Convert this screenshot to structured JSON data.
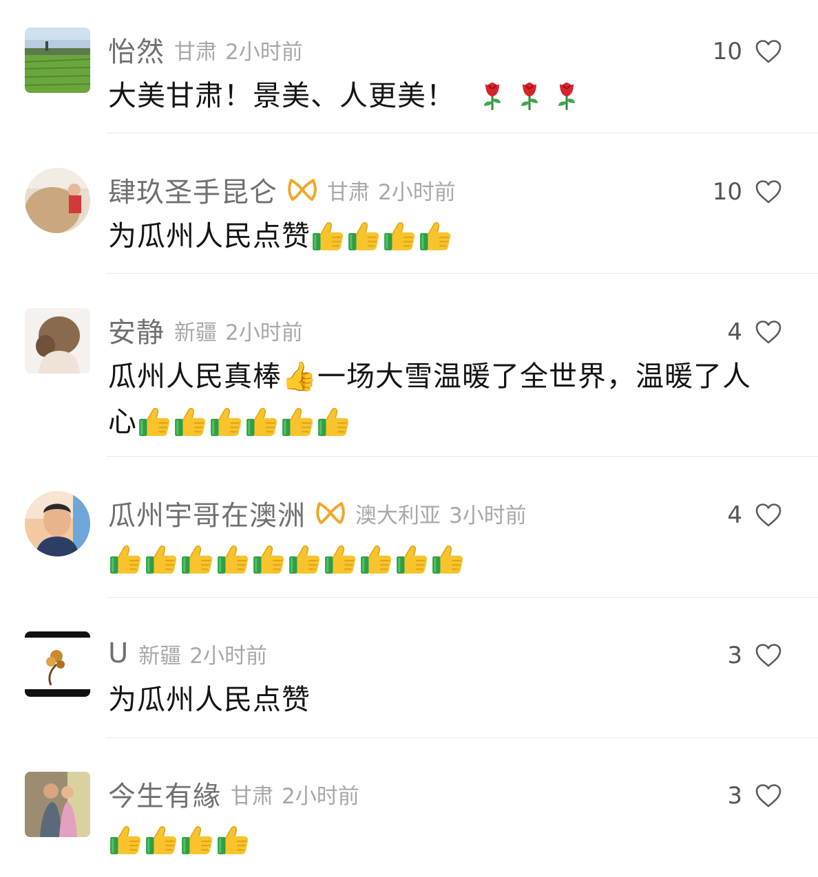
{
  "colors": {
    "username": "#707070",
    "meta": "#a8a8a8",
    "text": "#141414",
    "like_count": "#555555",
    "divider": "#e8e8e8",
    "badge": "#f4a528"
  },
  "comments": [
    {
      "username": "怡然",
      "location": "甘肃",
      "time": "2小时前",
      "likes": "10",
      "lines": [
        "大美甘肃！景美、人更美！"
      ],
      "trailing_emoji": {
        "icon": "rose-emoji",
        "count": 3
      },
      "has_badge": false,
      "avatar": "rice-field-avatar"
    },
    {
      "username": "肆玖圣手昆仑",
      "location": "甘肃",
      "time": "2小时前",
      "likes": "10",
      "lines": [
        "为瓜州人民点赞"
      ],
      "trailing_emoji": {
        "icon": "thumbs-up-emoji",
        "count": 4
      },
      "has_badge": true,
      "avatar": "person-avatar"
    },
    {
      "username": "安静",
      "location": "新疆",
      "time": "2小时前",
      "likes": "4",
      "lines": [
        "瓜州人民真棒👍一场大雪温暖了全世界，温暖了人",
        "心"
      ],
      "trailing_emoji": {
        "icon": "thumbs-up-emoji",
        "count": 6
      },
      "has_badge": false,
      "avatar": "woman-hair-avatar"
    },
    {
      "username": "瓜州宇哥在澳洲",
      "location": "澳大利亚",
      "time": "3小时前",
      "likes": "4",
      "lines": [
        ""
      ],
      "trailing_emoji": {
        "icon": "thumbs-up-emoji",
        "count": 10
      },
      "has_badge": true,
      "avatar": "young-man-avatar"
    },
    {
      "username": "U",
      "location": "新疆",
      "time": "2小时前",
      "likes": "3",
      "lines": [
        "为瓜州人民点赞"
      ],
      "trailing_emoji": {
        "icon": "none",
        "count": 0
      },
      "has_badge": false,
      "avatar": "flower-art-avatar"
    },
    {
      "username": "今生有緣",
      "location": "甘肃",
      "time": "2小时前",
      "likes": "3",
      "lines": [
        ""
      ],
      "trailing_emoji": {
        "icon": "thumbs-up-emoji",
        "count": 4
      },
      "has_badge": false,
      "avatar": "family-photo-avatar"
    }
  ]
}
